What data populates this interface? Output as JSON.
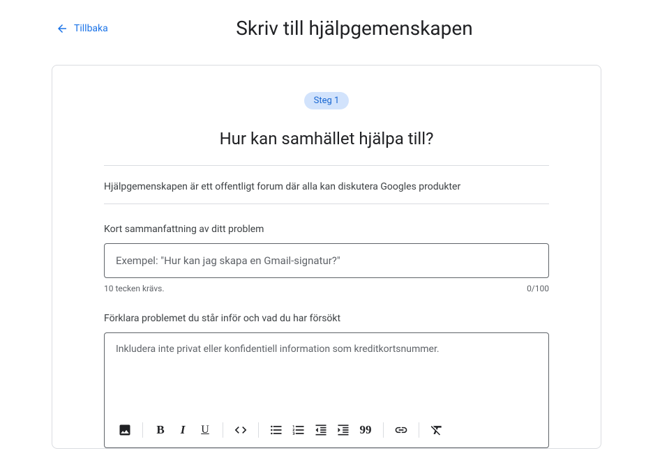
{
  "header": {
    "back_label": "Tillbaka",
    "title": "Skriv till hjälpgemenskapen"
  },
  "step": {
    "badge": "Steg 1",
    "title": "Hur kan samhället hjälpa till?"
  },
  "forum_description": "Hjälpgemenskapen är ett offentligt forum där alla kan diskutera Googles produkter",
  "summary": {
    "label": "Kort sammanfattning av ditt problem",
    "placeholder": "Exempel: \"Hur kan jag skapa en Gmail-signatur?\"",
    "value": "",
    "hint": "10 tecken krävs.",
    "counter": "0/100"
  },
  "details": {
    "label": "Förklara problemet du står inför och vad du har försökt",
    "placeholder": "Inkludera inte privat eller konfidentiell information som kreditkortsnummer.",
    "value": ""
  },
  "toolbar": {
    "image": "image-icon",
    "bold": "B",
    "italic": "I",
    "underline": "U",
    "code": "code-icon",
    "ul": "bulleted-list-icon",
    "ol": "numbered-list-icon",
    "outdent": "outdent-icon",
    "indent": "indent-icon",
    "quote": "99",
    "link": "link-icon",
    "clear": "clear-format-icon"
  }
}
